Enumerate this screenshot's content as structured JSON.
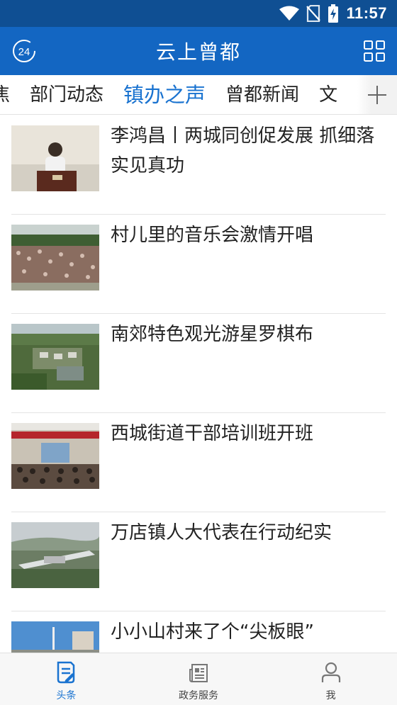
{
  "status_bar": {
    "time": "11:57"
  },
  "app_bar": {
    "title": "云上曾都",
    "left_icon_text": "24"
  },
  "tabs": [
    {
      "label": "焦",
      "active": false
    },
    {
      "label": "部门动态",
      "active": false
    },
    {
      "label": "镇办之声",
      "active": true
    },
    {
      "label": "曾都新闻",
      "active": false
    },
    {
      "label": "文",
      "active": false
    }
  ],
  "news": [
    {
      "headline": "李鸿昌丨两城同创促发展 抓细落实见真功",
      "thumb_icon": "meeting-speaker-photo"
    },
    {
      "headline": "村儿里的音乐会激情开唱",
      "thumb_icon": "outdoor-concert-crowd-photo"
    },
    {
      "headline": "南郊特色观光游星罗棋布",
      "thumb_icon": "aerial-countryside-photo"
    },
    {
      "headline": "西城街道干部培训班开班",
      "thumb_icon": "training-hall-photo"
    },
    {
      "headline": "万店镇人大代表在行动纪实",
      "thumb_icon": "aerial-town-photo"
    },
    {
      "headline": "小小山村来了个“尖板眼”",
      "thumb_icon": "village-street-photo"
    }
  ],
  "bottom_nav": [
    {
      "label": "头条",
      "icon": "news-doc-icon",
      "active": true
    },
    {
      "label": "政务服务",
      "icon": "newspaper-icon",
      "active": false
    },
    {
      "label": "我",
      "icon": "user-icon",
      "active": false
    }
  ],
  "colors": {
    "status_bar": "#0f4f93",
    "app_bar": "#1366c2",
    "accent": "#1a73d0"
  }
}
